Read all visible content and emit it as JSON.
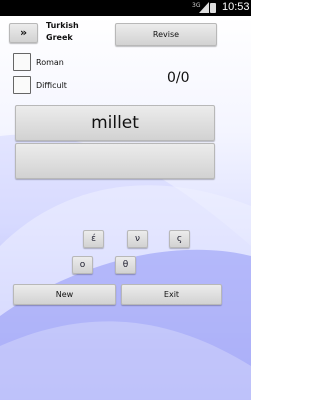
{
  "status_bar": {
    "network": "3G",
    "time": "10:53"
  },
  "top": {
    "expand_label": "»",
    "language_from": "Turkish",
    "language_to": "Greek",
    "revise_label": "Revise"
  },
  "options": [
    {
      "label": "Roman",
      "checked": false
    },
    {
      "label": "Difficult",
      "checked": false
    }
  ],
  "score": "0/0",
  "word": "millet",
  "answer": "",
  "keys": [
    "έ",
    "ν",
    "ς",
    "ο",
    "θ"
  ],
  "actions": {
    "new_label": "New",
    "exit_label": "Exit"
  }
}
